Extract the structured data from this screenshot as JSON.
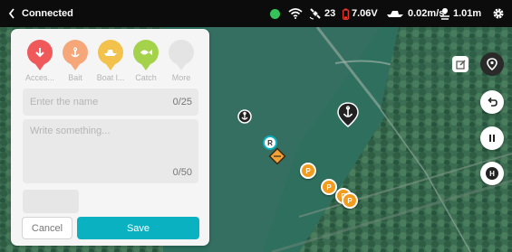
{
  "status_bar": {
    "back_icon": "chevron-left-icon",
    "connection": "Connected",
    "signal_color": "#35c25a",
    "satellites": "23",
    "battery": "7.06V",
    "speed": "0.02m/s",
    "depth": "1.01m"
  },
  "panel": {
    "categories": [
      {
        "label": "Acces...",
        "icon": "arrow-down-icon",
        "color": "#f0595a"
      },
      {
        "label": "Bait",
        "icon": "anchor-icon",
        "color": "#f6a77a"
      },
      {
        "label": "Boat l...",
        "icon": "boat-icon",
        "color": "#f3c24c"
      },
      {
        "label": "Catch",
        "icon": "fish-icon",
        "color": "#a4d24a"
      },
      {
        "label": "More",
        "icon": "more-icon",
        "color": "#e4e4e4"
      }
    ],
    "name_placeholder": "Enter the name",
    "name_counter": "0/25",
    "desc_placeholder": "Write something...",
    "desc_counter": "0/50",
    "cancel_label": "Cancel",
    "save_label": "Save"
  },
  "map": {
    "boat_marker_label": "R",
    "home_marker_label": "H",
    "waypoint_label": "P",
    "water_color": "#2f6a59",
    "accent": "#0ab1c1"
  }
}
